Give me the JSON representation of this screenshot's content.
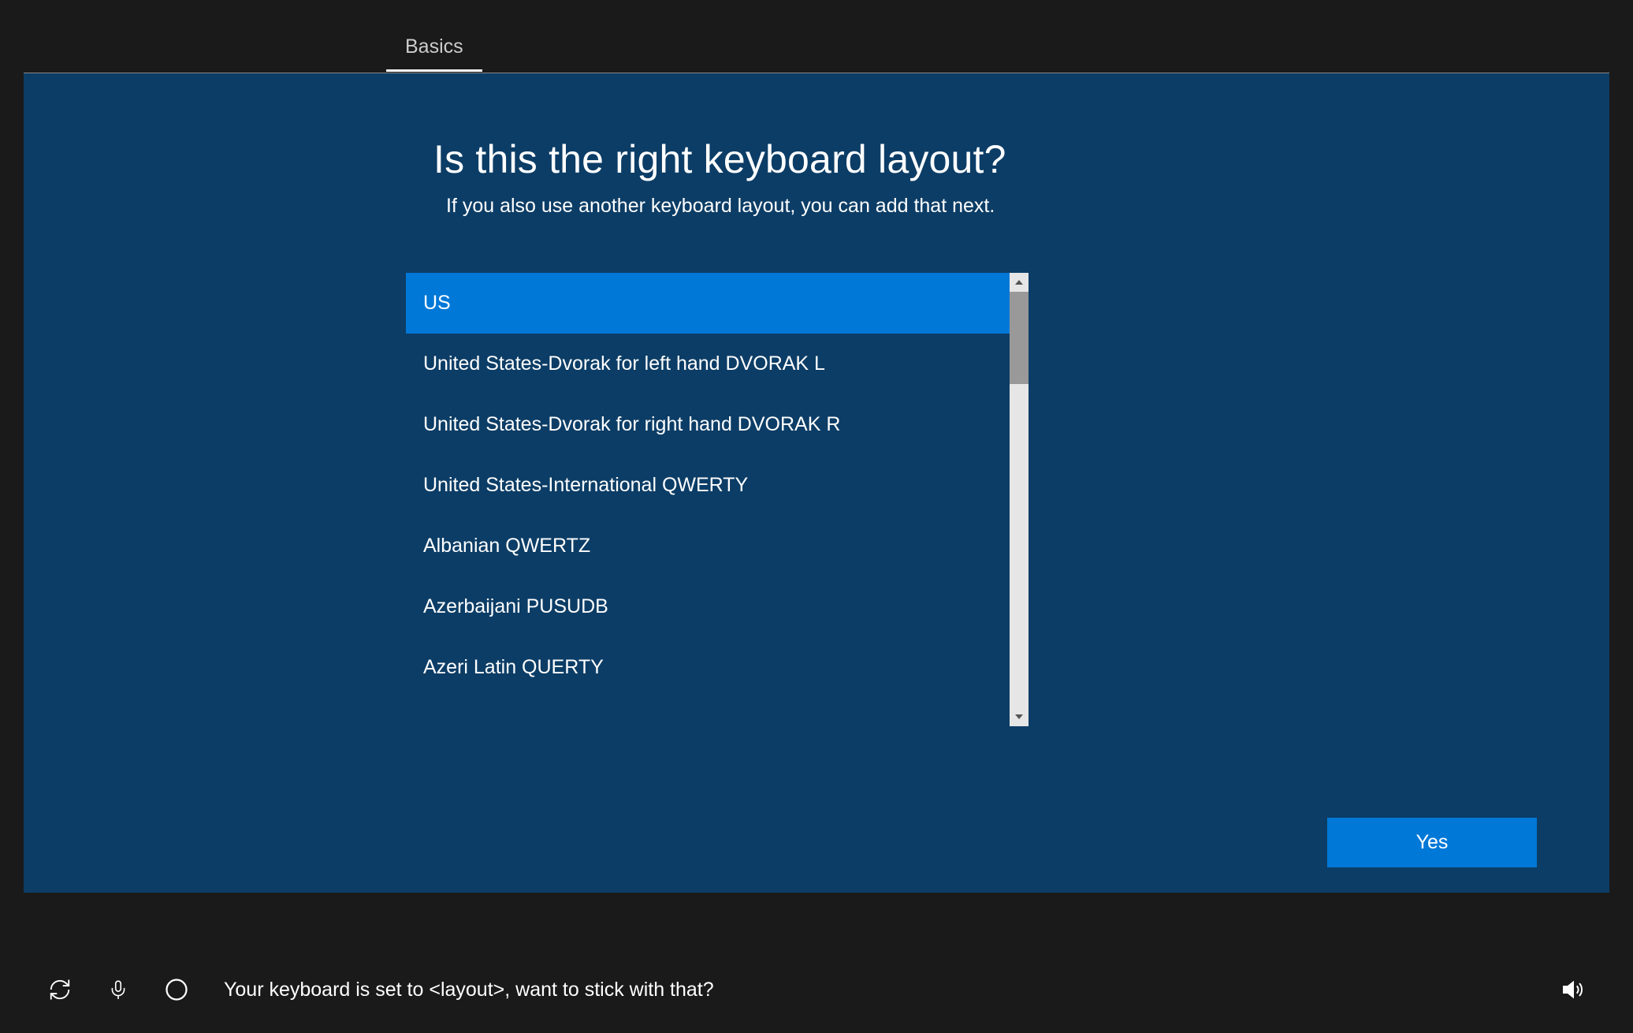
{
  "header": {
    "tab_label": "Basics"
  },
  "main": {
    "heading": "Is this the right keyboard layout?",
    "subheading": "If you also use another keyboard layout, you can add that next.",
    "layouts": [
      {
        "label": "US",
        "selected": true
      },
      {
        "label": "United States-Dvorak for left hand DVORAK L",
        "selected": false
      },
      {
        "label": "United States-Dvorak for right hand DVORAK R",
        "selected": false
      },
      {
        "label": "United States-International QWERTY",
        "selected": false
      },
      {
        "label": "Albanian QWERTZ",
        "selected": false
      },
      {
        "label": "Azerbaijani PUSUDB",
        "selected": false
      },
      {
        "label": "Azeri Latin QUERTY",
        "selected": false
      }
    ],
    "confirm_button": "Yes"
  },
  "footer": {
    "cortana_text": "Your keyboard is set to <layout>, want to stick with that?"
  }
}
